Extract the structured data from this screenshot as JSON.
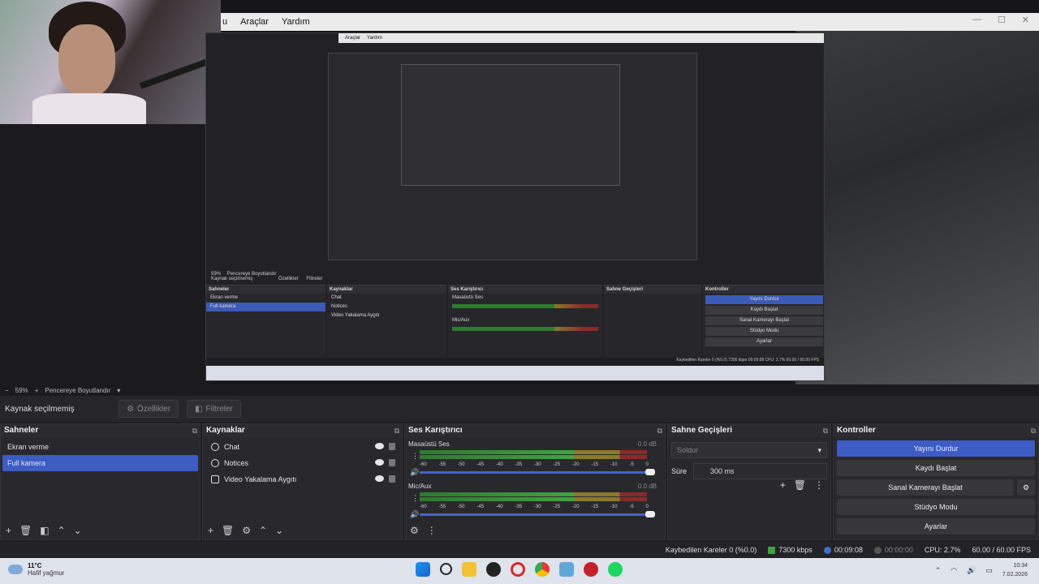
{
  "preview": {
    "menu": [
      "u",
      "Araçlar",
      "Yardım"
    ],
    "nested_menu": [
      "Araçlar",
      "Yardım"
    ],
    "nested_zoom": "59%",
    "nested_resize": "Pencereye Boyutlandır",
    "nested_source_label": "Kaynak seçilmemiş",
    "nested_props": "Özellikler",
    "nested_filters": "Filtreler",
    "nested_scenes_title": "Sahneler",
    "nested_scenes": [
      "Ekran verme",
      "Full kamera"
    ],
    "nested_sources_title": "Kaynaklar",
    "nested_sources": [
      "Chat",
      "Notices",
      "Video Yakalama Aygıtı"
    ],
    "nested_mixer_title": "Ses Karıştırıcı",
    "nested_mixer": [
      "Masaüstü Ses",
      "Mic/Aux"
    ],
    "nested_trans_title": "Sahne Geçişleri",
    "nested_controls_title": "Kontroller",
    "nested_controls": [
      "Yayını Durdur",
      "Kaydı Başlat",
      "Sanal Kamerayı Başlat",
      "Stüdyo Modu",
      "Ayarlar"
    ],
    "nested_status": "Kaybedilen Kareler 0 (%0.0)   7300 kbps   00:09:08   CPU: 2.7%   60.00 / 60.00 FPS"
  },
  "zoom": {
    "minus": "−",
    "value": "59%",
    "plus": "+",
    "resize_label": "Pencereye Boyutlandır",
    "dropdown": "▾"
  },
  "source_toolbar": {
    "label": "Kaynak seçilmemiş",
    "properties": "Özellikler",
    "filters": "Filtreler"
  },
  "scenes": {
    "title": "Sahneler",
    "items": [
      "Ekran verme",
      "Full kamera"
    ],
    "selected": 1
  },
  "sources": {
    "title": "Kaynaklar",
    "items": [
      "Chat",
      "Notices",
      "Video Yakalama Aygıtı"
    ]
  },
  "mixer": {
    "title": "Ses Karıştırıcı",
    "channels": [
      {
        "name": "Masaüstü Ses",
        "db": "0.0 dB"
      },
      {
        "name": "Mic/Aux",
        "db": "0.0 dB"
      }
    ],
    "scale": [
      "-60",
      "-55",
      "-50",
      "-45",
      "-40",
      "-35",
      "-30",
      "-25",
      "-20",
      "-15",
      "-10",
      "-5",
      "0"
    ]
  },
  "transitions": {
    "title": "Sahne Geçişleri",
    "selected": "Soldur",
    "duration_label": "Süre",
    "duration_value": "300 ms"
  },
  "controls": {
    "title": "Kontroller",
    "stop_stream": "Yayını Durdur",
    "start_record": "Kaydı Başlat",
    "start_virtualcam": "Sanal Kamerayı Başlat",
    "studio_mode": "Stüdyo Modu",
    "settings": "Ayarlar"
  },
  "status": {
    "dropped": "Kaybedilen Kareler 0 (%0.0)",
    "bitrate": "7300 kbps",
    "stream_time": "00:09:08",
    "record_time": "00:00:00",
    "cpu": "CPU: 2.7%",
    "fps": "60.00 / 60.00 FPS"
  },
  "taskbar": {
    "temp": "11°C",
    "weather": "Hafif yağmur",
    "time": "10:34",
    "date": "7.02.2026"
  },
  "colors": {
    "accent": "#3d5dc5",
    "panel": "#29292d",
    "taskbar": "#dfe3ec"
  }
}
